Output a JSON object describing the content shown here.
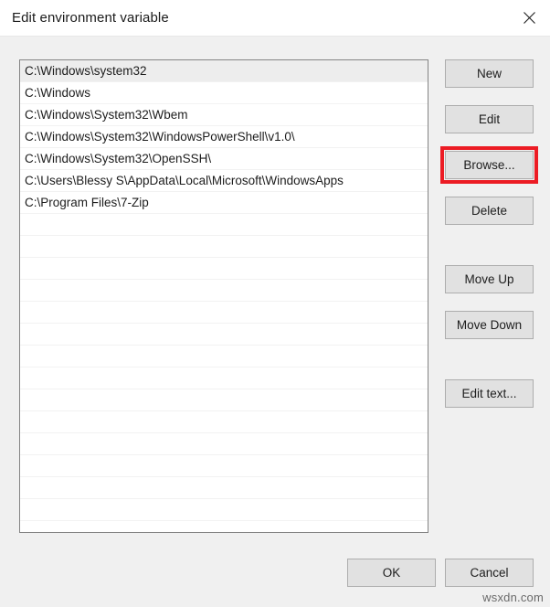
{
  "window": {
    "title": "Edit environment variable",
    "close_icon": "close-icon"
  },
  "path_list": {
    "selected_index": 0,
    "entries": [
      "C:\\Windows\\system32",
      "C:\\Windows",
      "C:\\Windows\\System32\\Wbem",
      "C:\\Windows\\System32\\WindowsPowerShell\\v1.0\\",
      "C:\\Windows\\System32\\OpenSSH\\",
      "C:\\Users\\Blessy S\\AppData\\Local\\Microsoft\\WindowsApps",
      "C:\\Program Files\\7-Zip"
    ],
    "empty_row_count": 14
  },
  "side_buttons": {
    "new": "New",
    "edit": "Edit",
    "browse": "Browse...",
    "delete": "Delete",
    "move_up": "Move Up",
    "move_down": "Move Down",
    "edit_text": "Edit text..."
  },
  "footer_buttons": {
    "ok": "OK",
    "cancel": "Cancel"
  },
  "annotation": {
    "highlight_target": "browse",
    "highlight_color": "#ec1c24"
  },
  "watermark": {
    "text": "wsxdn.com"
  }
}
